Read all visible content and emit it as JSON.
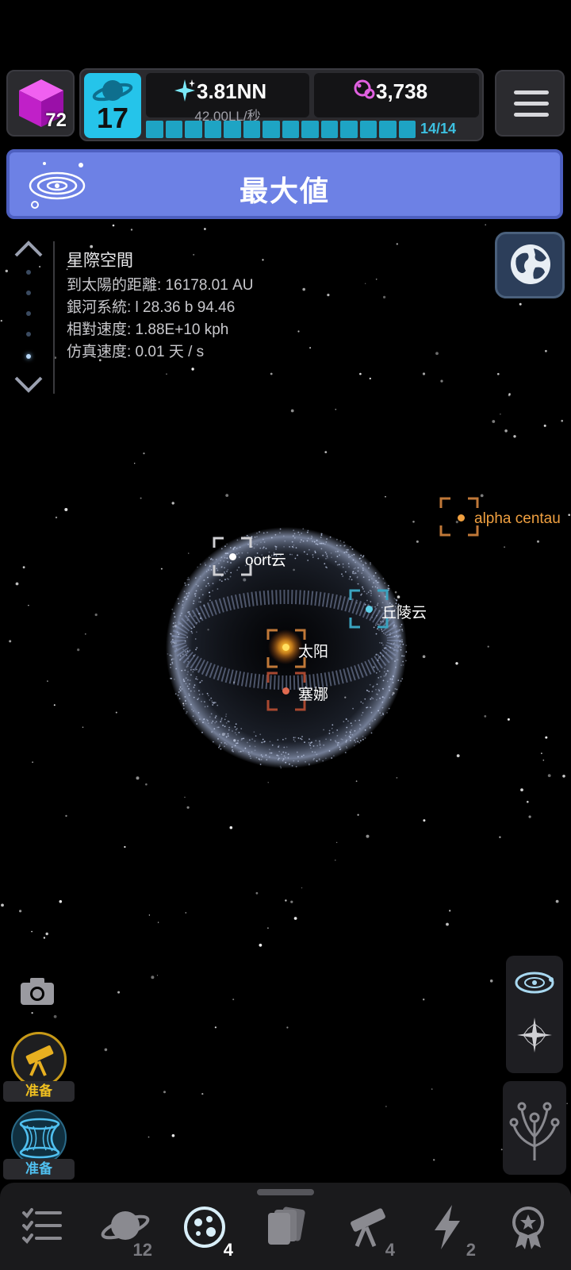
{
  "hud": {
    "cube_count": "72",
    "level": "17",
    "energy_value": "3.81NN",
    "energy_rate": "42.00LL/秒",
    "orbit_value": "3,738",
    "progress_text": "14/14",
    "progress_fraction": 1.0
  },
  "banner": {
    "title": "最大値"
  },
  "info": {
    "title": "星際空間",
    "lines": [
      "到太陽的距離: 16178.01 AU",
      "銀河系統: l 28.36 b 94.46",
      "相對速度: 1.88E+10 kph",
      "仿真速度: 0.01 天 / s"
    ]
  },
  "map": {
    "oort": "oort云",
    "hills": "丘陵云",
    "sun": "太阳",
    "sedna": "塞娜",
    "alpha": "alpha centau"
  },
  "tools": {
    "telescope_ready": "准备",
    "wormhole_ready": "准备"
  },
  "nav": {
    "items": [
      {
        "icon": "checklist-icon",
        "badge": ""
      },
      {
        "icon": "planet-icon",
        "badge": "12"
      },
      {
        "icon": "cluster-icon",
        "badge": "4"
      },
      {
        "icon": "cards-icon",
        "badge": ""
      },
      {
        "icon": "telescope-icon",
        "badge": "4"
      },
      {
        "icon": "lightning-icon",
        "badge": "2"
      },
      {
        "icon": "award-icon",
        "badge": ""
      }
    ]
  },
  "colors": {
    "banner": "#6d81e5",
    "level_bg": "#25c4ea",
    "progress": "#1ea4c4",
    "sun": "#f5b21a",
    "sedna": "#e06a50",
    "hills": "#5fd0e8",
    "alpha": "#f0a040"
  }
}
